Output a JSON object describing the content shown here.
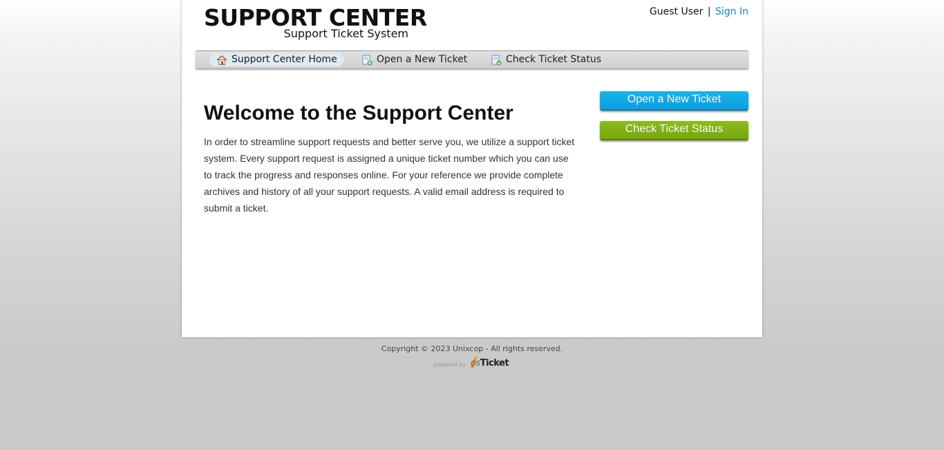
{
  "header": {
    "logo_title": "SUPPORT CENTER",
    "logo_subtitle": "Support Ticket System",
    "user_label": "Guest User",
    "separator": "|",
    "sign_in_label": "Sign In"
  },
  "nav": {
    "items": [
      {
        "label": "Support Center Home",
        "icon": "home-icon",
        "active": true
      },
      {
        "label": "Open a New Ticket",
        "icon": "new-ticket-icon",
        "active": false
      },
      {
        "label": "Check Ticket Status",
        "icon": "ticket-status-icon",
        "active": false
      }
    ]
  },
  "main": {
    "title": "Welcome to the Support Center",
    "body": "In order to streamline support requests and better serve you, we utilize a support ticket system. Every support request is assigned a unique ticket number which you can use to track the progress and responses online. For your reference we provide complete archives and history of all your support requests. A valid email address is required to submit a ticket."
  },
  "sidebar": {
    "open_ticket_label": "Open a New Ticket",
    "check_status_label": "Check Ticket Status"
  },
  "footer": {
    "copyright": "Copyright © 2023 Unixcop - All rights reserved.",
    "powered_by": "powered by",
    "brand_os": "os",
    "brand_ticket": "Ticket"
  },
  "colors": {
    "link": "#1782c7",
    "open_button": "#0ca0df",
    "check_button": "#78a70c"
  }
}
